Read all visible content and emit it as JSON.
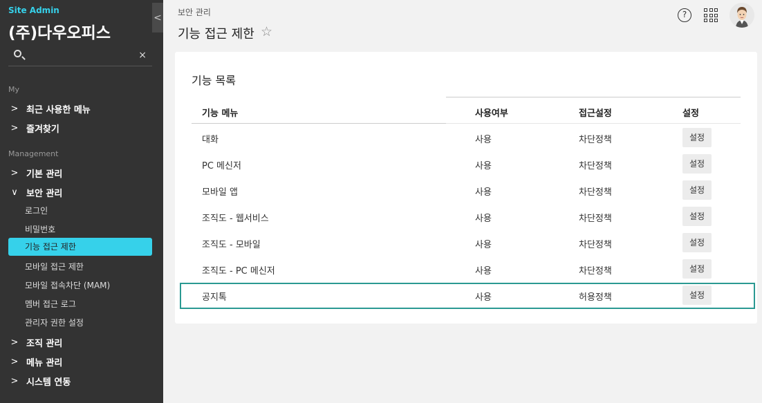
{
  "sidebar": {
    "site_admin": "Site Admin",
    "company": "(주)다우오피스",
    "search": {
      "placeholder": "",
      "clear": "×"
    },
    "sections": {
      "my": "My",
      "management": "Management"
    },
    "my_items": [
      {
        "label": "최근 사용한 메뉴",
        "chevron": ">"
      },
      {
        "label": "즐겨찾기",
        "chevron": ">"
      }
    ],
    "management_items": {
      "basic": {
        "label": "기본 관리",
        "chevron": ">"
      },
      "security": {
        "label": "보안 관리",
        "chevron": "∨"
      },
      "org": {
        "label": "조직 관리",
        "chevron": ">"
      },
      "menu": {
        "label": "메뉴 관리",
        "chevron": ">"
      },
      "system": {
        "label": "시스템 연동",
        "chevron": ">"
      }
    },
    "security_sub": [
      "로그인",
      "비밀번호",
      "기능 접근 제한",
      "모바일 접근 제한",
      "모바일 접속차단 (MAM)",
      "멤버 접근 로그",
      "관리자 권한 설정"
    ],
    "collapse_icon": "<"
  },
  "header": {
    "breadcrumb": "보안 관리",
    "title": "기능 접근 제한",
    "star": "☆",
    "help": "?"
  },
  "card": {
    "title": "기능 목록",
    "columns": [
      "기능 메뉴",
      "사용여부",
      "접근설정",
      "설정"
    ],
    "rows": [
      {
        "menu": "대화",
        "use": "사용",
        "access": "차단정책",
        "action": "설정"
      },
      {
        "menu": "PC 메신저",
        "use": "사용",
        "access": "차단정책",
        "action": "설정"
      },
      {
        "menu": "모바일 앱",
        "use": "사용",
        "access": "차단정책",
        "action": "설정"
      },
      {
        "menu": "조직도 - 웹서비스",
        "use": "사용",
        "access": "차단정책",
        "action": "설정"
      },
      {
        "menu": "조직도 - 모바일",
        "use": "사용",
        "access": "차단정책",
        "action": "설정"
      },
      {
        "menu": "조직도 - PC 메신저",
        "use": "사용",
        "access": "차단정책",
        "action": "설정"
      },
      {
        "menu": "공지톡",
        "use": "사용",
        "access": "허용정책",
        "action": "설정"
      }
    ]
  },
  "colors": {
    "accent": "#36d1ea",
    "sidebar_bg": "#333333",
    "highlight_border": "#2a9992"
  }
}
